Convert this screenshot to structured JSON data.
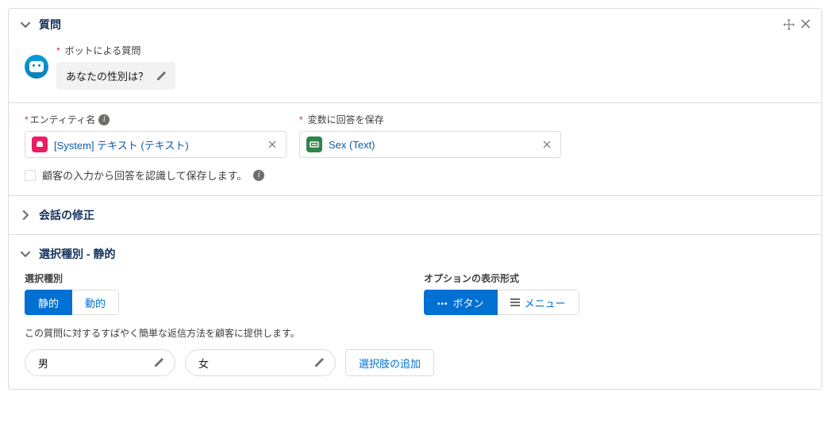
{
  "header": {
    "title": "質問"
  },
  "bot_question": {
    "label": "ボットによる質問",
    "value": "あなたの性別は？"
  },
  "entity": {
    "label": "エンティティ名",
    "value": "[System] テキスト (テキスト)"
  },
  "variable": {
    "label": "変数に回答を保存",
    "value": "Sex (Text)"
  },
  "recognize_checkbox": {
    "label": "顧客の入力から回答を認識して保存します。"
  },
  "conversation_fix": {
    "title": "会話の修正"
  },
  "choice_section": {
    "title": "選択種別 - 静的",
    "type_label": "選択種別",
    "display_label": "オプションの表示形式",
    "type_options": {
      "static": "静的",
      "dynamic": "動的"
    },
    "display_options": {
      "button": "ボタン",
      "menu": "メニュー"
    },
    "description": "この質問に対するすばやく簡単な返信方法を顧客に提供します。",
    "choices": [
      "男",
      "女"
    ],
    "add_label": "選択肢の追加"
  }
}
